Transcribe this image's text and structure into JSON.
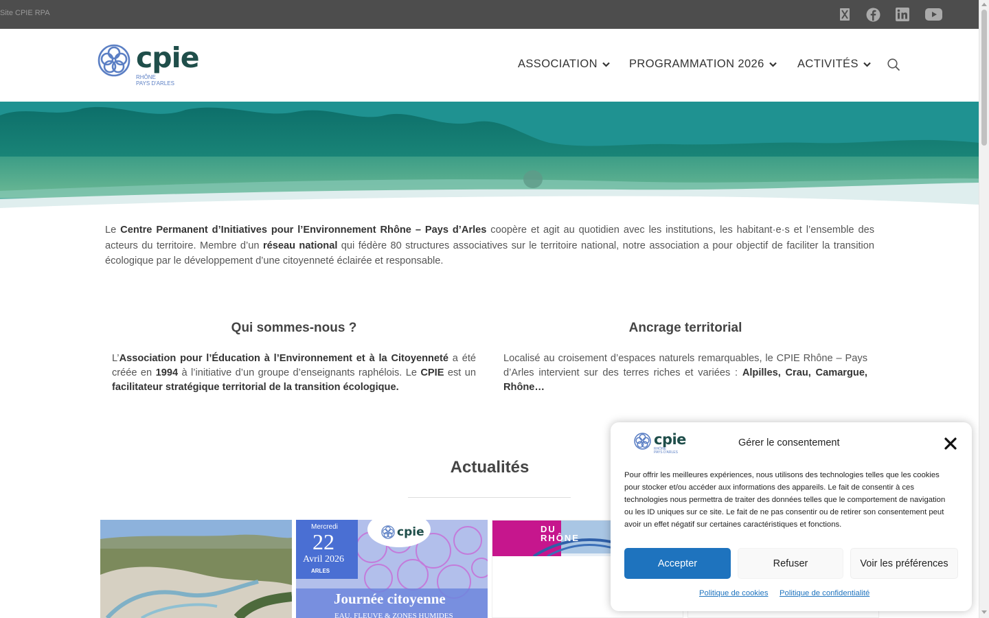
{
  "topbar": {
    "site_label": "Site CPIE RPA",
    "social": [
      "x-icon",
      "facebook-icon",
      "linkedin-icon",
      "youtube-icon"
    ]
  },
  "header": {
    "logo_word": "cpie",
    "logo_line1": "RHÔNE",
    "logo_line2": "PAYS D'ARLES",
    "nav": [
      {
        "label": "ASSOCIATION"
      },
      {
        "label": "PROGRAMMATION 2026"
      },
      {
        "label": "ACTIVITÉS"
      }
    ]
  },
  "intro": {
    "p1": "Le ",
    "b1": "Centre Permanent d’Initiatives pour l’Environnement Rhône – Pays d’Arles",
    "p2": " coopère et agit au quotidien avec les institutions, les habitant·e·s et l’ensemble des acteurs du territoire. Membre d’un ",
    "b2": "réseau national",
    "p3": " qui fédère 80 structures associatives sur le territoire national, notre association a pour objectif de faciliter la transition écologique par le développement d’une citoyenneté éclairée et responsable."
  },
  "col1": {
    "title": "Qui sommes-nous ?",
    "t1": "L’",
    "b1": "Association pour l’Éducation à l’Environnement et à la Citoyenneté",
    "t2": "  a été créée en ",
    "b2": "1994",
    "t3": " à l’initiative d’un groupe d’enseignants raphélois.  Le ",
    "b3": "CPIE",
    "t4": " est un ",
    "b4": "facilitateur stratégique territorial de la transition écologique."
  },
  "col2": {
    "title": "Ancrage territorial",
    "t1": "Localisé au croisement d’espaces naturels remarquables, le CPIE Rhône – Pays d’Arles intervient sur des terres riches et variées : ",
    "b1": "Alpilles, Crau, Camargue, Rhône…"
  },
  "news": {
    "title": "Actualités",
    "card2": {
      "day_label": "Mercredi",
      "day": "22",
      "month": "Avril 2026",
      "city": "ARLES",
      "logo_word": "cpie",
      "headline": "Journée citoyenne",
      "subline": "EAU, FLEUVE & ZONES HUMIDES"
    },
    "card3": {
      "banner": "DU\nRHÔNE"
    }
  },
  "consent": {
    "logo_word": "cpie",
    "logo_line1": "RHÔNE",
    "logo_line2": "PAYS D'ARLES",
    "title": "Gérer le consentement",
    "text": "Pour offrir les meilleures expériences, nous utilisons des technologies telles que les cookies pour stocker et/ou accéder aux informations des appareils. Le fait de consentir à ces technologies nous permettra de traiter des données telles que le comportement de navigation ou les ID uniques sur ce site. Le fait de ne pas consentir ou de retirer son consentement peut avoir un effet négatif sur certaines caractéristiques et fonctions.",
    "accept": "Accepter",
    "refuse": "Refuser",
    "prefs": "Voir les préférences",
    "link_cookies": "Politique de cookies",
    "link_privacy": "Politique de confidentialité"
  },
  "colors": {
    "topbar": "#4d4d4d",
    "brand_dark": "#1f4e4a",
    "brand_blue": "#5b7fc4",
    "accept_button": "#1e73be"
  }
}
